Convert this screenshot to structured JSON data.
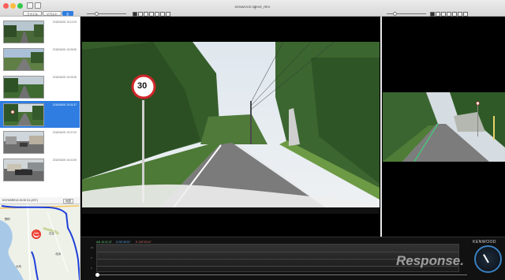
{
  "window": {
    "title": "KENWOOD DRIVE_REV"
  },
  "tabs": [
    {
      "label": "ファイル"
    },
    {
      "label": "イベント"
    },
    {
      "label": "全"
    }
  ],
  "list": {
    "items": [
      {
        "timestamp": "2018/06/20 15:12:23"
      },
      {
        "timestamp": "2018/06/20 15:25:55"
      },
      {
        "timestamp": "2018/06/20 15:29:25"
      },
      {
        "timestamp": "2018/06/20 15:31:37"
      },
      {
        "timestamp": "2018/06/20 15:37:02"
      },
      {
        "timestamp": "2018/06/20 15:41:59"
      }
    ],
    "selected_index": 3
  },
  "map": {
    "header_left": "KSYNSRE15 15:32 01 (JST)",
    "button_label": "地図",
    "place_labels": [
      "野町",
      "日比",
      "北浜",
      "大桁"
    ],
    "start_marker": "⛔"
  },
  "main_video": {
    "sign_text": "30"
  },
  "bottom": {
    "readouts": [
      {
        "text": "AM 15:31:37",
        "color": "#5fd27a"
      },
      {
        "text": "N 35°46'23\"",
        "color": "#5aa9e6"
      },
      {
        "text": "E 139°30'41\"",
        "color": "#e27272"
      }
    ],
    "logo": "KENWOOD",
    "watermark": "Response.",
    "gauge_scale": [
      "0",
      "5",
      "10"
    ],
    "timeline_progress": 0.0
  },
  "colors": {
    "accent": "#2f7de1",
    "route": "#1f3fd8"
  }
}
